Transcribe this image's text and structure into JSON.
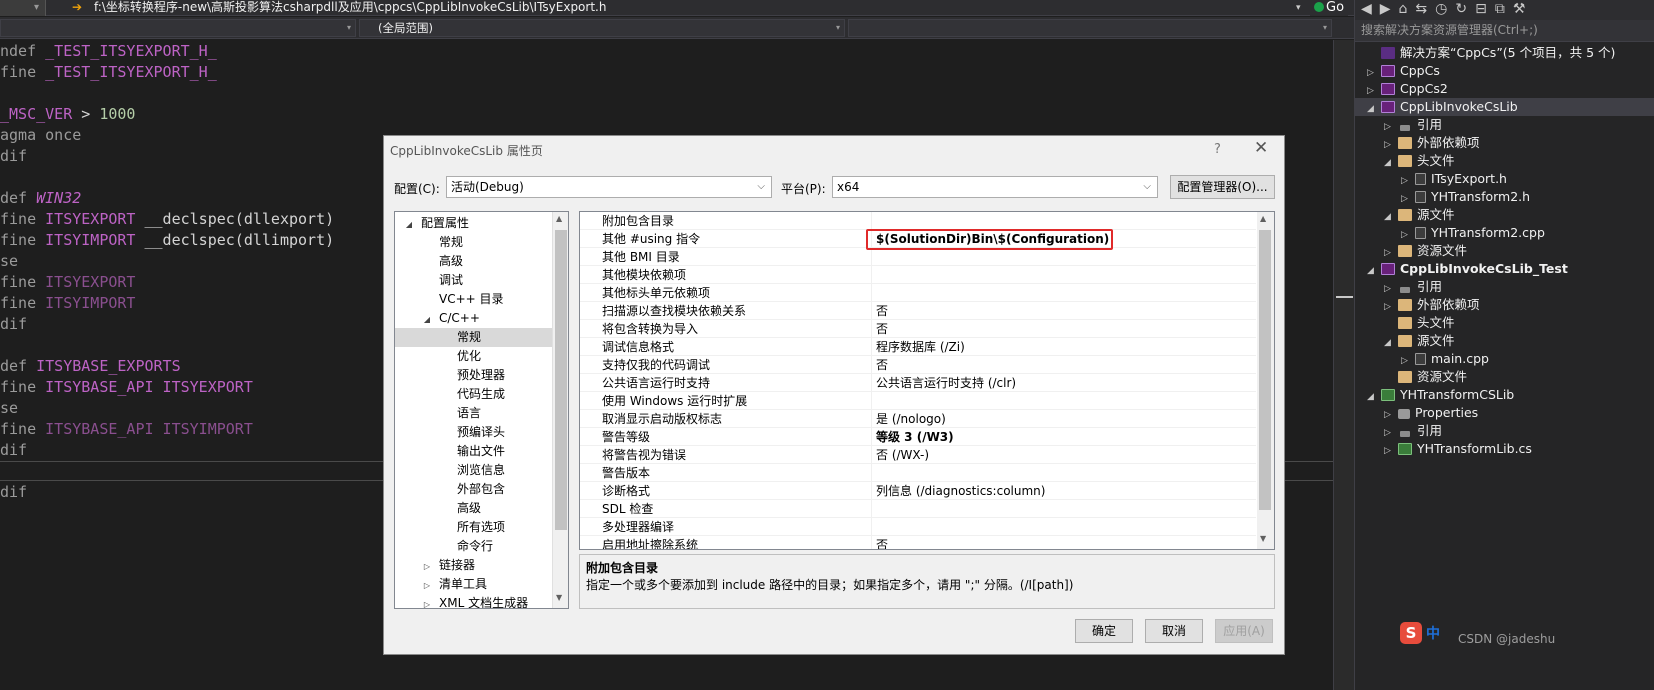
{
  "editor": {
    "file_path": "f:\\坐标转换程序-new\\高斯投影算法csharpdll及应用\\cppcs\\CppLibInvokeCsLib\\ITsyExport.h",
    "go_label": "Go",
    "scope_middle": "(全局范围)",
    "lines": [
      {
        "p1": "ndef",
        "p2": " _TEST_ITSYEXPORT_H_",
        "p3": "",
        "p4": ""
      },
      {
        "p1": "fine",
        "p2": " _TEST_ITSYEXPORT_H_",
        "p3": "",
        "p4": ""
      },
      {
        "p1": "",
        "p2": "",
        "p3": "",
        "p4": ""
      },
      {
        "p1": "",
        "p2": "_MSC_VER",
        "p3": " > ",
        "p4": "1000"
      },
      {
        "p1": "agma once",
        "p2": "",
        "p3": "",
        "p4": ""
      },
      {
        "p1": "dif",
        "p2": "",
        "p3": "",
        "p4": ""
      },
      {
        "p1": "",
        "p2": "",
        "p3": "",
        "p4": ""
      },
      {
        "p1": "def",
        "p2": " WIN32",
        "p3": "",
        "p4": ""
      },
      {
        "p1": "fine",
        "p2": " ITSYEXPORT",
        "p3": " __declspec(dllexport)",
        "p4": ""
      },
      {
        "p1": "fine",
        "p2": " ITSYIMPORT",
        "p3": " __declspec(dllimport)",
        "p4": ""
      },
      {
        "p1": "se",
        "p2": "",
        "p3": "",
        "p4": ""
      },
      {
        "p1": "fine",
        "p2": " ITSYEXPORT",
        "p3": "",
        "p4": ""
      },
      {
        "p1": "fine",
        "p2": " ITSYIMPORT",
        "p3": "",
        "p4": ""
      },
      {
        "p1": "dif",
        "p2": "",
        "p3": "",
        "p4": ""
      },
      {
        "p1": "",
        "p2": "",
        "p3": "",
        "p4": ""
      },
      {
        "p1": "def",
        "p2": " ITSYBASE_EXPORTS",
        "p3": "",
        "p4": ""
      },
      {
        "p1": "fine",
        "p2": " ITSYBASE_API",
        "p3": " ITSYEXPORT",
        "p4": ""
      },
      {
        "p1": "se",
        "p2": "",
        "p3": "",
        "p4": ""
      },
      {
        "p1": "fine",
        "p2": " ITSYBASE_API",
        "p3": " ITSYIMPORT",
        "p4": ""
      },
      {
        "p1": "dif",
        "p2": "",
        "p3": "",
        "p4": ""
      },
      {
        "p1": "",
        "p2": "",
        "p3": "",
        "p4": ""
      },
      {
        "p1": "dif",
        "p2": "",
        "p3": "",
        "p4": ""
      }
    ]
  },
  "solution_explorer": {
    "toolbar_icons": [
      "back-icon",
      "forward-icon",
      "home-icon",
      "switch-views-icon",
      "history-icon",
      "sync-icon",
      "collapse-all-icon",
      "copy-icon",
      "properties-icon"
    ],
    "search_placeholder": "搜索解决方案资源管理器(Ctrl+;)",
    "nodes": [
      {
        "label": "解决方案“CppCs”(5 个项目，共 5 个)",
        "icon": "solution-icon",
        "kind": "sol",
        "tri": "",
        "indent": 0,
        "bold": false,
        "sel": false
      },
      {
        "label": "CppCs",
        "icon": "cpp-project-icon",
        "kind": "proj",
        "tri": "▷",
        "indent": 0,
        "bold": false,
        "sel": false
      },
      {
        "label": "CppCs2",
        "icon": "cpp-project-icon",
        "kind": "proj",
        "tri": "▷",
        "indent": 0,
        "bold": false,
        "sel": false
      },
      {
        "label": "CppLibInvokeCsLib",
        "icon": "cpp-project-icon",
        "kind": "proj",
        "tri": "◢",
        "indent": 0,
        "bold": false,
        "sel": true
      },
      {
        "label": "引用",
        "icon": "references-icon",
        "kind": "ref",
        "tri": "▷",
        "indent": 1,
        "bold": false,
        "sel": false
      },
      {
        "label": "外部依赖项",
        "icon": "folder-icon",
        "kind": "fold",
        "tri": "▷",
        "indent": 1,
        "bold": false,
        "sel": false
      },
      {
        "label": "头文件",
        "icon": "folder-icon",
        "kind": "fold",
        "tri": "◢",
        "indent": 1,
        "bold": false,
        "sel": false
      },
      {
        "label": "ITsyExport.h",
        "icon": "header-file-icon",
        "kind": "file",
        "tri": "▷",
        "indent": 2,
        "bold": false,
        "sel": false
      },
      {
        "label": "YHTransform2.h",
        "icon": "header-file-icon",
        "kind": "file",
        "tri": "▷",
        "indent": 2,
        "bold": false,
        "sel": false
      },
      {
        "label": "源文件",
        "icon": "folder-icon",
        "kind": "fold",
        "tri": "◢",
        "indent": 1,
        "bold": false,
        "sel": false
      },
      {
        "label": "YHTransform2.cpp",
        "icon": "cpp-file-icon",
        "kind": "file",
        "tri": "▷",
        "indent": 2,
        "bold": false,
        "sel": false
      },
      {
        "label": "资源文件",
        "icon": "folder-icon",
        "kind": "fold",
        "tri": "▷",
        "indent": 1,
        "bold": false,
        "sel": false
      },
      {
        "label": "CppLibInvokeCsLib_Test",
        "icon": "cpp-project-icon",
        "kind": "proj",
        "tri": "◢",
        "indent": 0,
        "bold": true,
        "sel": false
      },
      {
        "label": "引用",
        "icon": "references-icon",
        "kind": "ref",
        "tri": "▷",
        "indent": 1,
        "bold": false,
        "sel": false
      },
      {
        "label": "外部依赖项",
        "icon": "folder-icon",
        "kind": "fold",
        "tri": "▷",
        "indent": 1,
        "bold": false,
        "sel": false
      },
      {
        "label": "头文件",
        "icon": "folder-icon",
        "kind": "fold",
        "tri": "",
        "indent": 1,
        "bold": false,
        "sel": false
      },
      {
        "label": "源文件",
        "icon": "folder-icon",
        "kind": "fold",
        "tri": "◢",
        "indent": 1,
        "bold": false,
        "sel": false
      },
      {
        "label": "main.cpp",
        "icon": "cpp-file-icon",
        "kind": "file",
        "tri": "▷",
        "indent": 2,
        "bold": false,
        "sel": false
      },
      {
        "label": "资源文件",
        "icon": "folder-icon",
        "kind": "fold",
        "tri": "",
        "indent": 1,
        "bold": false,
        "sel": false
      },
      {
        "label": "YHTransformCSLib",
        "icon": "csharp-project-icon",
        "kind": "cs",
        "tri": "◢",
        "indent": 0,
        "bold": false,
        "sel": false
      },
      {
        "label": "Properties",
        "icon": "wrench-icon",
        "kind": "wrench",
        "tri": "▷",
        "indent": 1,
        "bold": false,
        "sel": false
      },
      {
        "label": "引用",
        "icon": "references-icon",
        "kind": "ref",
        "tri": "▷",
        "indent": 1,
        "bold": false,
        "sel": false
      },
      {
        "label": "YHTransformLib.cs",
        "icon": "csharp-file-icon",
        "kind": "cs",
        "tri": "▷",
        "indent": 1,
        "bold": false,
        "sel": false
      }
    ]
  },
  "dialog": {
    "title": "CppLibInvokeCsLib 属性页",
    "help_label": "?",
    "close_label": "✕",
    "config_label": "配置(C):",
    "config_value": "活动(Debug)",
    "platform_label": "平台(P):",
    "platform_value": "x64",
    "config_manager_label": "配置管理器(O)...",
    "tree": [
      {
        "label": "配置属性",
        "tri": "◢",
        "indent": 0,
        "sel": false
      },
      {
        "label": "常规",
        "tri": "",
        "indent": 1,
        "sel": false
      },
      {
        "label": "高级",
        "tri": "",
        "indent": 1,
        "sel": false
      },
      {
        "label": "调试",
        "tri": "",
        "indent": 1,
        "sel": false
      },
      {
        "label": "VC++ 目录",
        "tri": "",
        "indent": 1,
        "sel": false
      },
      {
        "label": "C/C++",
        "tri": "◢",
        "indent": 1,
        "sel": false
      },
      {
        "label": "常规",
        "tri": "",
        "indent": 2,
        "sel": true
      },
      {
        "label": "优化",
        "tri": "",
        "indent": 2,
        "sel": false
      },
      {
        "label": "预处理器",
        "tri": "",
        "indent": 2,
        "sel": false
      },
      {
        "label": "代码生成",
        "tri": "",
        "indent": 2,
        "sel": false
      },
      {
        "label": "语言",
        "tri": "",
        "indent": 2,
        "sel": false
      },
      {
        "label": "预编译头",
        "tri": "",
        "indent": 2,
        "sel": false
      },
      {
        "label": "输出文件",
        "tri": "",
        "indent": 2,
        "sel": false
      },
      {
        "label": "浏览信息",
        "tri": "",
        "indent": 2,
        "sel": false
      },
      {
        "label": "外部包含",
        "tri": "",
        "indent": 2,
        "sel": false
      },
      {
        "label": "高级",
        "tri": "",
        "indent": 2,
        "sel": false
      },
      {
        "label": "所有选项",
        "tri": "",
        "indent": 2,
        "sel": false
      },
      {
        "label": "命令行",
        "tri": "",
        "indent": 2,
        "sel": false
      },
      {
        "label": "链接器",
        "tri": "▷",
        "indent": 1,
        "sel": false
      },
      {
        "label": "清单工具",
        "tri": "▷",
        "indent": 1,
        "sel": false
      },
      {
        "label": "XML 文档生成器",
        "tri": "▷",
        "indent": 1,
        "sel": false
      }
    ],
    "properties": [
      {
        "name": "附加包含目录",
        "value": "",
        "bold": false
      },
      {
        "name": "其他 #using 指令",
        "value": "$(SolutionDir)Bin\\$(Configuration)",
        "bold": true
      },
      {
        "name": "其他 BMI 目录",
        "value": "",
        "bold": false
      },
      {
        "name": "其他模块依赖项",
        "value": "",
        "bold": false
      },
      {
        "name": "其他标头单元依赖项",
        "value": "",
        "bold": false
      },
      {
        "name": "扫描源以查找模块依赖关系",
        "value": "否",
        "bold": false
      },
      {
        "name": "将包含转换为导入",
        "value": "否",
        "bold": false
      },
      {
        "name": "调试信息格式",
        "value": "程序数据库 (/Zi)",
        "bold": false
      },
      {
        "name": "支持仅我的代码调试",
        "value": "否",
        "bold": false
      },
      {
        "name": "公共语言运行时支持",
        "value": "公共语言运行时支持 (/clr)",
        "bold": false
      },
      {
        "name": "使用 Windows 运行时扩展",
        "value": "",
        "bold": false
      },
      {
        "name": "取消显示启动版权标志",
        "value": "是 (/nologo)",
        "bold": false
      },
      {
        "name": "警告等级",
        "value": "等级 3 (/W3)",
        "bold": true
      },
      {
        "name": "将警告视为错误",
        "value": "否 (/WX-)",
        "bold": false
      },
      {
        "name": "警告版本",
        "value": "",
        "bold": false
      },
      {
        "name": "诊断格式",
        "value": "列信息 (/diagnostics:column)",
        "bold": false
      },
      {
        "name": "SDL 检查",
        "value": "",
        "bold": false
      },
      {
        "name": "多处理器编译",
        "value": "",
        "bold": false
      },
      {
        "name": "启用地址擦除系统",
        "value": "否",
        "bold": false
      }
    ],
    "description_title": "附加包含目录",
    "description_text": "指定一个或多个要添加到 include 路径中的目录；如果指定多个，请用 \";\" 分隔。(/I[path])",
    "ok_label": "确定",
    "cancel_label": "取消",
    "apply_label": "应用(A)"
  },
  "watermark": {
    "logo_letter": "S",
    "logo_text": "中",
    "text": "CSDN @jadeshu"
  },
  "colors": {
    "highlight_box": "#e02a2a",
    "accent": "#007acc"
  }
}
